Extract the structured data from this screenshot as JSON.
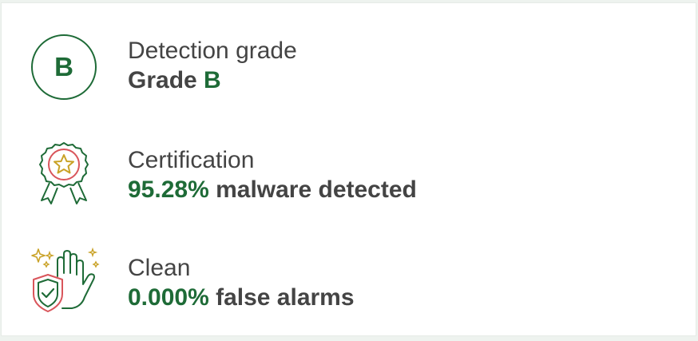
{
  "grade_item": {
    "badge_letter": "B",
    "label": "Detection grade",
    "value_prefix": "Grade ",
    "value_highlight": "B"
  },
  "certification_item": {
    "label": "Certification",
    "value_highlight": "95.28%",
    "value_suffix": " malware detected",
    "icon": "award-ribbon-star-icon"
  },
  "clean_item": {
    "label": "Clean",
    "value_highlight": "0.000%",
    "value_suffix": " false alarms",
    "icon": "hand-shield-sparkle-icon"
  },
  "colors": {
    "accent_green": "#1e6b37",
    "text_gray": "#444444",
    "icon_red": "#d9555b",
    "icon_gold": "#c9a227"
  }
}
